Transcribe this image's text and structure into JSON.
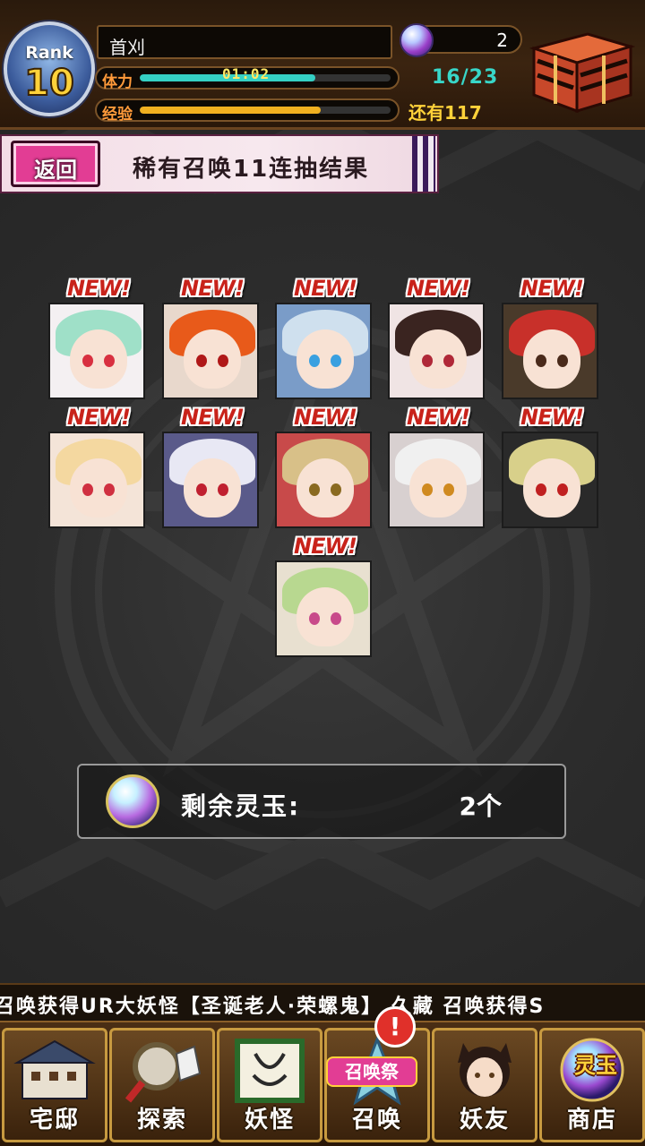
{
  "header": {
    "rank_label": "Rank",
    "rank_value": "10",
    "player_name": "首刈",
    "stamina_label": "体力",
    "stamina_timer": "01:02",
    "stamina_value": "16/23",
    "stamina_fraction": 0.7,
    "exp_label": "经验",
    "exp_fraction": 0.72,
    "exp_remaining": "还有117",
    "orb_count": "2",
    "chest_icon": "treasure-chest-icon",
    "colors": {
      "stamina_bar": "#35d0c4",
      "exp_bar": "#f0b020"
    }
  },
  "banner": {
    "back_label": "返回",
    "title": "稀有召唤11连抽结果"
  },
  "results": {
    "new_label": "NEW!",
    "cards": [
      {
        "hair": "#9fe0c8",
        "eye": "#d83040",
        "bg": "#f4f0f2"
      },
      {
        "hair": "#e85a1a",
        "eye": "#b01818",
        "bg": "#e8d8cc"
      },
      {
        "hair": "#cfe0ee",
        "eye": "#3aa0e0",
        "bg": "#7a9cc8"
      },
      {
        "hair": "#3a2420",
        "eye": "#b02838",
        "bg": "#f0e4e4"
      },
      {
        "hair": "#c8302a",
        "eye": "#4a2a1a",
        "bg": "#4a3a2a"
      },
      {
        "hair": "#f4d8a0",
        "eye": "#d03040",
        "bg": "#f4e4d8"
      },
      {
        "hair": "#e8e8f4",
        "eye": "#c02030",
        "bg": "#5a5a8a"
      },
      {
        "hair": "#d8c088",
        "eye": "#8a6a20",
        "bg": "#c84a4a"
      },
      {
        "hair": "#f0f0f0",
        "eye": "#d08a20",
        "bg": "#d8d0d0"
      },
      {
        "hair": "#d8d08a",
        "eye": "#c02020",
        "bg": "#2a2a2a"
      },
      {
        "hair": "#b8d890",
        "eye": "#c84a8a",
        "bg": "#e8e0d0"
      }
    ]
  },
  "remaining": {
    "label": "剩余灵玉:",
    "value": "2个",
    "orb_icon": "spirit-orb-icon"
  },
  "ticker": {
    "text": "召唤获得UR大妖怪【圣诞老人·荣螺鬼】   久藏 召唤获得S"
  },
  "nav": {
    "items": [
      {
        "label": "宅邸",
        "icon": "mansion-icon"
      },
      {
        "label": "探索",
        "icon": "magnifier-map-icon"
      },
      {
        "label": "妖怪",
        "icon": "scroll-icon"
      },
      {
        "label": "召唤",
        "icon": "summon-star-icon"
      },
      {
        "label": "妖友",
        "icon": "friend-catgirl-icon"
      },
      {
        "label": "商店",
        "icon": "shop-orb-icon"
      }
    ],
    "alert_mark": "!",
    "fest_label": "召唤祭",
    "shop_tag": "灵玉"
  }
}
